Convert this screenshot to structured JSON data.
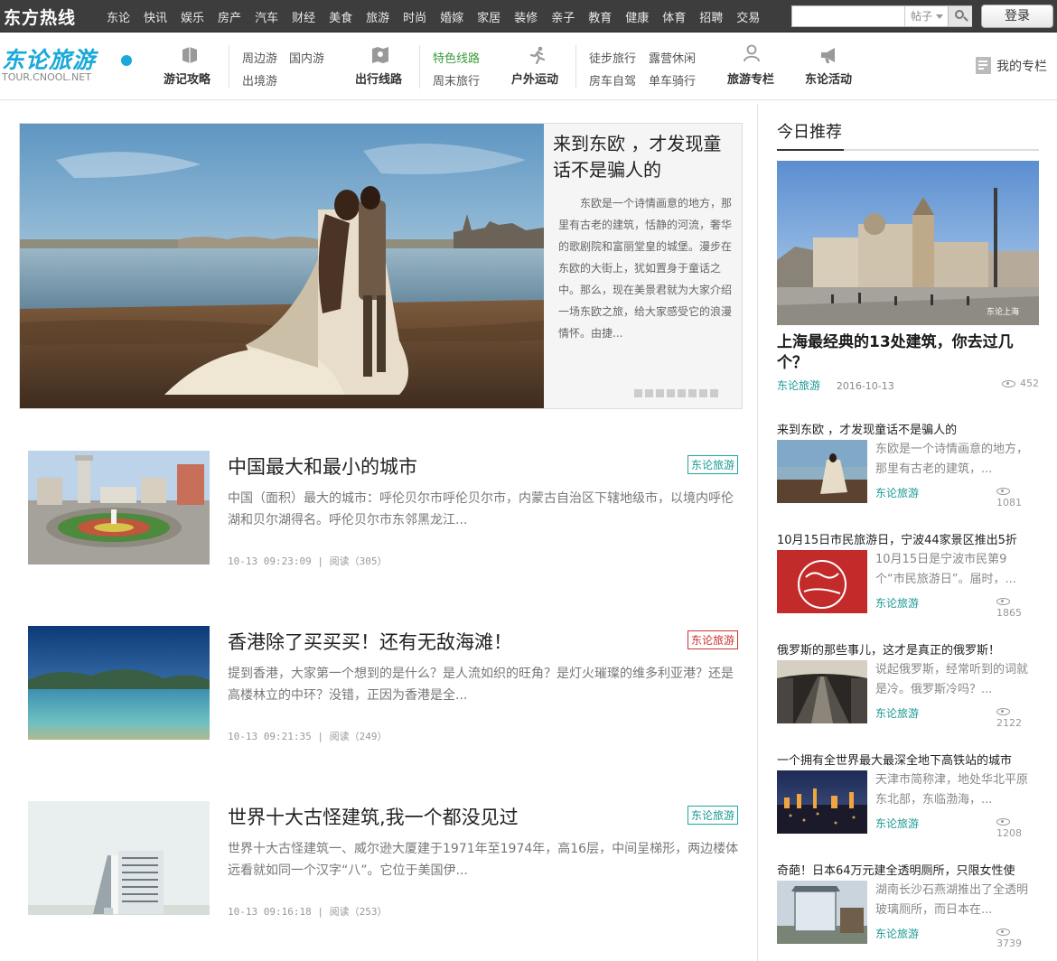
{
  "topbar": {
    "logo": "东方热线",
    "nav": [
      "东论",
      "快讯",
      "娱乐",
      "房产",
      "汽车",
      "财经",
      "美食",
      "旅游",
      "时尚",
      "婚嫁",
      "家居",
      "装修",
      "亲子",
      "教育",
      "健康",
      "体育",
      "招聘",
      "交易"
    ],
    "search_scope": "帖子",
    "login": "登录"
  },
  "brand": {
    "name": "东论旅游",
    "url": "TOUR.CNOOL.NET"
  },
  "nav2": {
    "g1_main": "游记攻略",
    "g1_sub": [
      "周边游",
      "国内游",
      "出境游"
    ],
    "g2_main": "出行线路",
    "g2_sub": [
      "特色线路",
      "周末旅行"
    ],
    "g3_main": "户外运动",
    "g3_sub": [
      "徒步旅行",
      "露营休闲",
      "房车自驾",
      "单车骑行"
    ],
    "g4_main": "旅游专栏",
    "g5_main": "东论活动",
    "my_column": "我的专栏"
  },
  "feature": {
    "title": "来到东欧 ，才发现童话不是骗人的",
    "desc": "东欧是一个诗情画意的地方，那里有古老的建筑，恬静的河流，奢华的歌剧院和富丽堂皇的城堡。漫步在东欧的大街上，犹如置身于童话之中。那么，现在美景君就为大家介绍一场东欧之旅，给大家感受它的浪漫情怀。由捷..."
  },
  "articles": [
    {
      "title": "中国最大和最小的城市",
      "tag": "东论旅游",
      "desc": "中国（面积）最大的城市：呼伦贝尔市呼伦贝尔市，内蒙古自治区下辖地级市，以境内呼伦湖和贝尔湖得名。呼伦贝尔市东邻黑龙江...",
      "time": "10-13 09:23:09",
      "reads": "阅读（305）"
    },
    {
      "title": "香港除了买买买！还有无敌海滩！",
      "tag": "东论旅游",
      "desc": "提到香港，大家第一个想到的是什么？是人流如织的旺角？是灯火璀璨的维多利亚港？还是高楼林立的中环？没错，正因为香港是全...",
      "time": "10-13 09:21:35",
      "reads": "阅读（249）"
    },
    {
      "title": "世界十大古怪建筑,我一个都没见过",
      "tag": "东论旅游",
      "desc": "世界十大古怪建筑一、威尔逊大厦建于1971年至1974年，高16层，中间呈梯形，两边楼体远看就如同一个汉字“八”。它位于美国伊...",
      "time": "10-13 09:16:18",
      "reads": "阅读（253）"
    }
  ],
  "sidebar": {
    "title": "今日推荐",
    "hero": {
      "title": "上海最经典的13处建筑，你去过几个？",
      "tag": "东论旅游",
      "date": "2016-10-13",
      "views": "452",
      "watermark": "东论上海"
    },
    "items": [
      {
        "title": "来到东欧 ，才发现童话不是骗人的",
        "desc": "东欧是一个诗情画意的地方，那里有古老的建筑，...",
        "tag": "东论旅游",
        "views": "1081"
      },
      {
        "title": "10月15日市民旅游日，宁波44家景区推出5折",
        "desc": "10月15日是宁波市民第9个“市民旅游日”。届时，...",
        "tag": "东论旅游",
        "views": "1865"
      },
      {
        "title": "俄罗斯的那些事儿，这才是真正的俄罗斯！",
        "desc": "说起俄罗斯，经常听到的词就是冷。俄罗斯冷吗？...",
        "tag": "东论旅游",
        "views": "2122"
      },
      {
        "title": "一个拥有全世界最大最深全地下高铁站的城市",
        "desc": "天津市简称津，地处华北平原东北部，东临渤海，...",
        "tag": "东论旅游",
        "views": "1208"
      },
      {
        "title": "奇葩！日本64万元建全透明厕所，只限女性使",
        "desc": "湖南长沙石燕湖推出了全透明玻璃厕所，而日本在...",
        "tag": "东论旅游",
        "views": "3739"
      }
    ]
  },
  "colors": {
    "accent": "#1aa9d8",
    "teal": "#1a9a95",
    "tag_red": "#cc3333",
    "topbar": "#3d3d3d"
  }
}
